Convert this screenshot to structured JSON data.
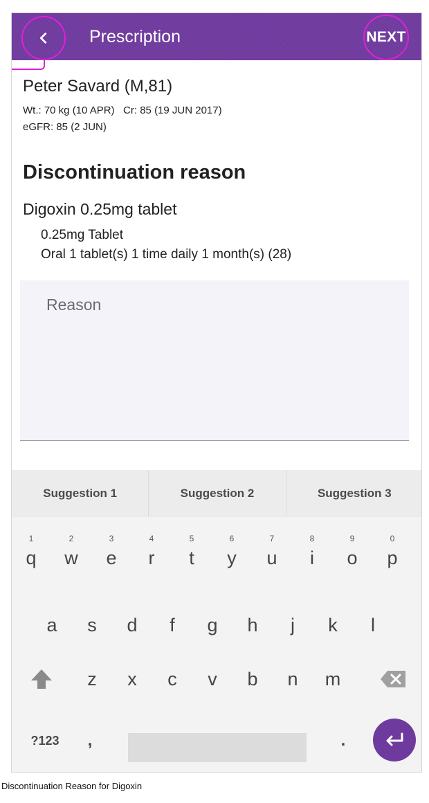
{
  "appbar": {
    "title": "Prescription",
    "back_icon": "chevron-left-icon",
    "next_label": "NEXT",
    "color": "#6f3a9e",
    "hotspot_color": "#e11fd8"
  },
  "patient": {
    "name": "Peter Savard (M,81)",
    "line1": "Wt.: 70 kg (10 APR)   Cr: 85 (19 JUN 2017)",
    "line2": "eGFR: 85 (2 JUN)"
  },
  "section_title": "Discontinuation reason",
  "drug": {
    "name": "Digoxin 0.25mg tablet",
    "form": "0.25mg Tablet",
    "sig": "Oral 1 tablet(s) 1 time daily 1 month(s) (28)"
  },
  "reason_field": {
    "placeholder": "Reason",
    "value": ""
  },
  "keyboard": {
    "suggestions": [
      "Suggestion 1",
      "Suggestion 2",
      "Suggestion 3"
    ],
    "row1": [
      {
        "ch": "q",
        "hint": "1"
      },
      {
        "ch": "w",
        "hint": "2"
      },
      {
        "ch": "e",
        "hint": "3"
      },
      {
        "ch": "r",
        "hint": "4"
      },
      {
        "ch": "t",
        "hint": "5"
      },
      {
        "ch": "y",
        "hint": "6"
      },
      {
        "ch": "u",
        "hint": "7"
      },
      {
        "ch": "i",
        "hint": "8"
      },
      {
        "ch": "o",
        "hint": "9"
      },
      {
        "ch": "p",
        "hint": "0"
      }
    ],
    "row2": [
      "a",
      "s",
      "d",
      "f",
      "g",
      "h",
      "j",
      "k",
      "l"
    ],
    "row3": [
      "z",
      "x",
      "c",
      "v",
      "b",
      "n",
      "m"
    ],
    "shift_icon": "shift-arrow-icon",
    "backspace_icon": "backspace-icon",
    "symbols_label": "?123",
    "comma_label": ",",
    "period_label": ".",
    "enter_icon": "enter-return-icon"
  },
  "caption": "Discontinuation Reason for Digoxin"
}
